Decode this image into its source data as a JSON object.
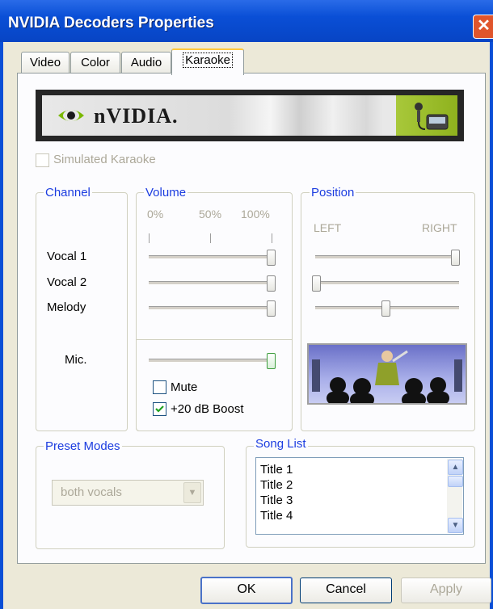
{
  "window": {
    "title": "NVIDIA Decoders Properties",
    "close_glyph": "✕"
  },
  "tabs": [
    {
      "label": "Video"
    },
    {
      "label": "Color"
    },
    {
      "label": "Audio"
    },
    {
      "label": "Karaoke",
      "active": true
    }
  ],
  "banner": {
    "brand": "nVIDIA."
  },
  "simulated_karaoke": {
    "label": "Simulated Karaoke",
    "checked": false,
    "enabled": false
  },
  "channel": {
    "title": "Channel",
    "rows": [
      "Vocal 1",
      "Vocal 2",
      "Melody"
    ],
    "mic_label": "Mic."
  },
  "volume": {
    "title": "Volume",
    "scale": [
      "0%",
      "50%",
      "100%"
    ],
    "vocal1": 1.0,
    "vocal2": 1.0,
    "melody": 1.0,
    "mic": 1.0
  },
  "position": {
    "title": "Position",
    "left_label": "LEFT",
    "right_label": "RIGHT",
    "vocal1": 1.0,
    "vocal2": 0.0,
    "melody": 0.5
  },
  "mute": {
    "label": "Mute",
    "checked": false
  },
  "boost": {
    "label": "+20 dB Boost",
    "checked": true
  },
  "preset_modes": {
    "title": "Preset Modes",
    "selected": "both vocals",
    "enabled": false
  },
  "song_list": {
    "title": "Song List",
    "items": [
      "Title 1",
      "Title 2",
      "Title 3",
      "Title 4"
    ]
  },
  "buttons": {
    "ok": "OK",
    "cancel": "Cancel",
    "apply": "Apply"
  },
  "colors": {
    "titlebar": "#0a4fd6",
    "group_label": "#1c3de0",
    "disabled_text": "#aca899",
    "nvidia_green": "#8fb21e"
  }
}
